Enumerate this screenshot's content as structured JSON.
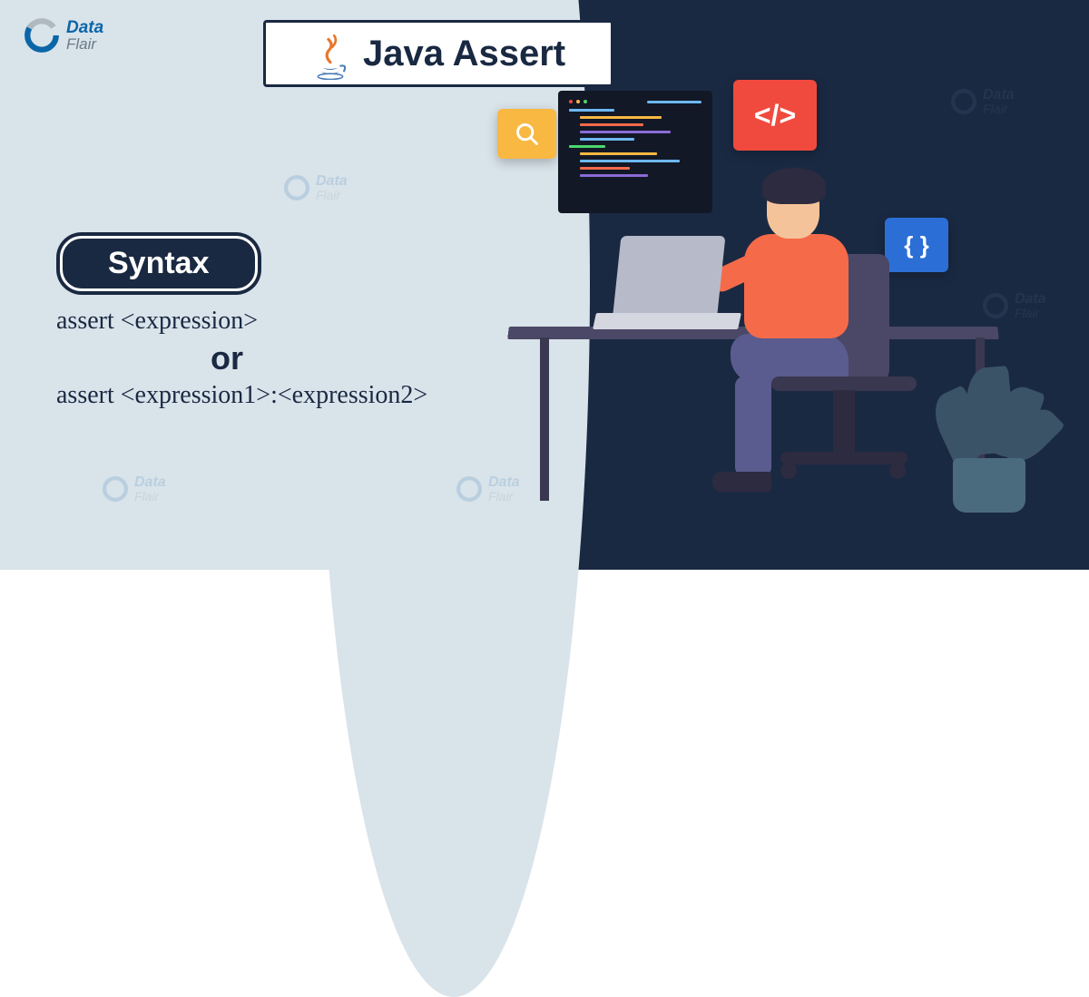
{
  "logo": {
    "brand_top": "Data",
    "brand_bottom": "Flair"
  },
  "title": "Java Assert",
  "syntax_label": "Syntax",
  "code": {
    "line1": "assert <expression>",
    "or": "or",
    "line2": "assert <expression1>:<expression2>"
  },
  "panels": {
    "code_tag": "</>",
    "braces": "{ }"
  },
  "colors": {
    "dark": "#1a2942",
    "light": "#d9e3ea",
    "orange": "#f56b4a",
    "red": "#f04a3e",
    "yellow": "#f9b842",
    "blue": "#2b6fd6"
  }
}
